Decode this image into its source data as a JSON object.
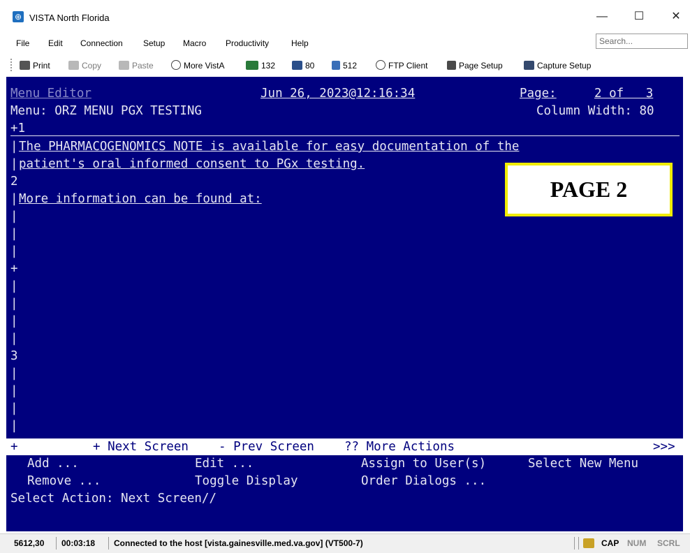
{
  "window": {
    "title": "VISTA North Florida",
    "minimize": "—",
    "maximize": "☐",
    "close": "✕"
  },
  "menubar": {
    "items": [
      "File",
      "Edit",
      "Connection",
      "Setup",
      "Macro",
      "Productivity",
      "Help"
    ],
    "search_placeholder": "Search..."
  },
  "toolbar": {
    "items": [
      {
        "label": "Print",
        "icon": "printer-icon"
      },
      {
        "label": "Copy",
        "icon": "copy-icon"
      },
      {
        "label": "Paste",
        "icon": "paste-icon"
      },
      {
        "label": "More VistA",
        "icon": "more-vista-icon"
      },
      {
        "label": "132",
        "icon": "columns-132-icon"
      },
      {
        "label": "80",
        "icon": "columns-80-icon"
      },
      {
        "label": "512",
        "icon": "buffer-512-icon"
      },
      {
        "label": "FTP Client",
        "icon": "ftp-icon"
      },
      {
        "label": "Page Setup",
        "icon": "page-setup-icon"
      },
      {
        "label": "Capture Setup",
        "icon": "capture-icon"
      }
    ]
  },
  "terminal": {
    "header": {
      "menu_editor": "Menu Editor",
      "datetime": "Jun 26, 2023@12:16:34",
      "page_label": "Page:",
      "page_value": "2 of   3",
      "menu_line": "Menu: ORZ MENU PGX TESTING",
      "column_width": "Column Width: 80"
    },
    "lines": {
      "plus1": "+1",
      "note_line1": "The PHARMACOGENOMICS NOTE is available for easy documentation of the",
      "note_line2": "patient's oral informed consent to PGx testing.",
      "two": "2",
      "more_info": "More information can be found at:",
      "plus": "+",
      "three": "3"
    },
    "action_bar": {
      "plus": "+",
      "next": "+ Next Screen",
      "prev": "- Prev Screen",
      "more": "?? More Actions",
      "more_indicator": ">>>"
    },
    "actions": {
      "add": "Add ...",
      "edit": "Edit ...",
      "assign": "Assign to User(s)",
      "select_new_menu": "Select New Menu",
      "remove": "Remove ...",
      "toggle": "Toggle Display",
      "order": "Order Dialogs ..."
    },
    "prompt": "Select Action: Next Screen//",
    "callout": "PAGE 2"
  },
  "statusbar": {
    "position": "5612,30",
    "elapsed": "00:03:18",
    "connection": "Connected to the host [vista.gainesville.med.va.gov] (VT500-7)",
    "cap": "CAP",
    "num": "NUM",
    "scrl": "SCRL"
  },
  "colors": {
    "terminal_bg": "#00007e",
    "terminal_fg": "#e6e6f2",
    "callout_border": "#f0ec00"
  }
}
